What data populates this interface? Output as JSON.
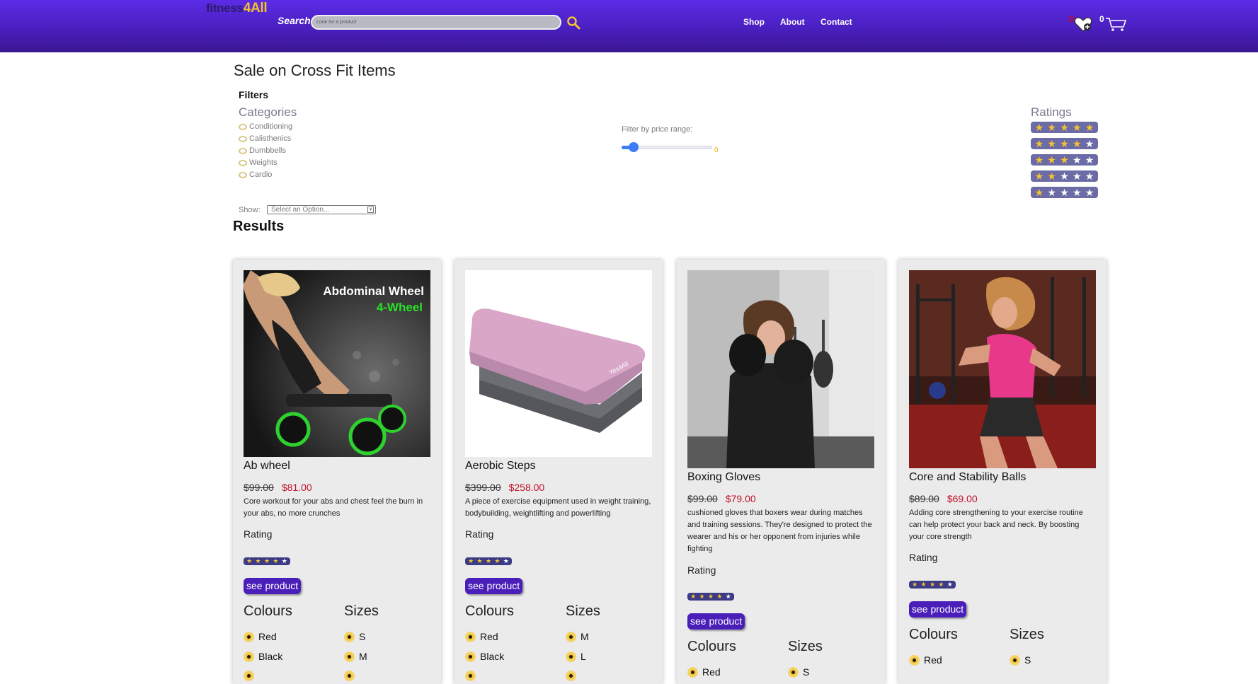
{
  "header": {
    "logo_part1": "fitness",
    "logo_part2": "4All",
    "search_label": "Search:",
    "search_placeholder": "Look for a product",
    "nav": [
      "Shop",
      "About",
      "Contact"
    ],
    "wishlist_count": "0",
    "cart_count": "0"
  },
  "page_title": "Sale on Cross Fit Items",
  "filters": {
    "heading": "Filters",
    "categories_heading": "Categories",
    "categories": [
      "Conditioning",
      "Calisthenics",
      "Dumbbells",
      "Weights",
      "Cardio"
    ],
    "price_label": "Filter by price range:",
    "price_value": "0",
    "ratings_heading": "Ratings",
    "ratings": [
      5,
      4,
      3,
      2,
      1
    ],
    "show_label": "Show:",
    "show_selected": "Select an Option..."
  },
  "results_heading": "Results",
  "card_labels": {
    "rating": "Rating",
    "see_product": "see product",
    "colours": "Colours",
    "sizes": "Sizes"
  },
  "products": [
    {
      "name": "Ab wheel",
      "old_price": "$99.00",
      "new_price": "$81.00",
      "description": "Core workout for your abs and chest feel the burn in your abs, no more crunches",
      "rating": 4,
      "image_text_1": "Abdominal Wheel",
      "image_text_2": "4-Wheel",
      "colours": [
        "Red",
        "Black"
      ],
      "sizes": [
        "S",
        "M"
      ]
    },
    {
      "name": "Aerobic Steps",
      "old_price": "$399.00",
      "new_price": "$258.00",
      "description": "A piece of exercise equipment used in weight training, bodybuilding, weightlifting and powerlifting",
      "rating": 4,
      "image_text_1": "Yes4All",
      "colours": [
        "Red",
        "Black"
      ],
      "sizes": [
        "M",
        "L"
      ]
    },
    {
      "name": "Boxing Gloves",
      "old_price": "$99.00",
      "new_price": "$79.00",
      "description": "cushioned gloves that boxers wear during matches and training sessions. They're designed to protect the wearer and his or her opponent from injuries while fighting",
      "rating": 4,
      "colours": [
        "Red"
      ],
      "sizes": [
        "S"
      ]
    },
    {
      "name": "Core and Stability Balls",
      "old_price": "$89.00",
      "new_price": "$69.00",
      "description": "Adding core strengthening to your exercise routine can help protect your back and neck. By boosting your core strength",
      "rating": 4,
      "colours": [
        "Red"
      ],
      "sizes": [
        "S"
      ]
    }
  ],
  "colors": {
    "header_top": "#5b2ce6",
    "accent_yellow": "#f4c430",
    "sale_red": "#c0102a",
    "button_purple": "#4a1fb9",
    "rating_bg": "#6c6ba5"
  },
  "icons": {
    "search": "magnifier-icon",
    "wishlist": "heart-icon",
    "cart": "cart-icon",
    "star": "star-icon"
  }
}
